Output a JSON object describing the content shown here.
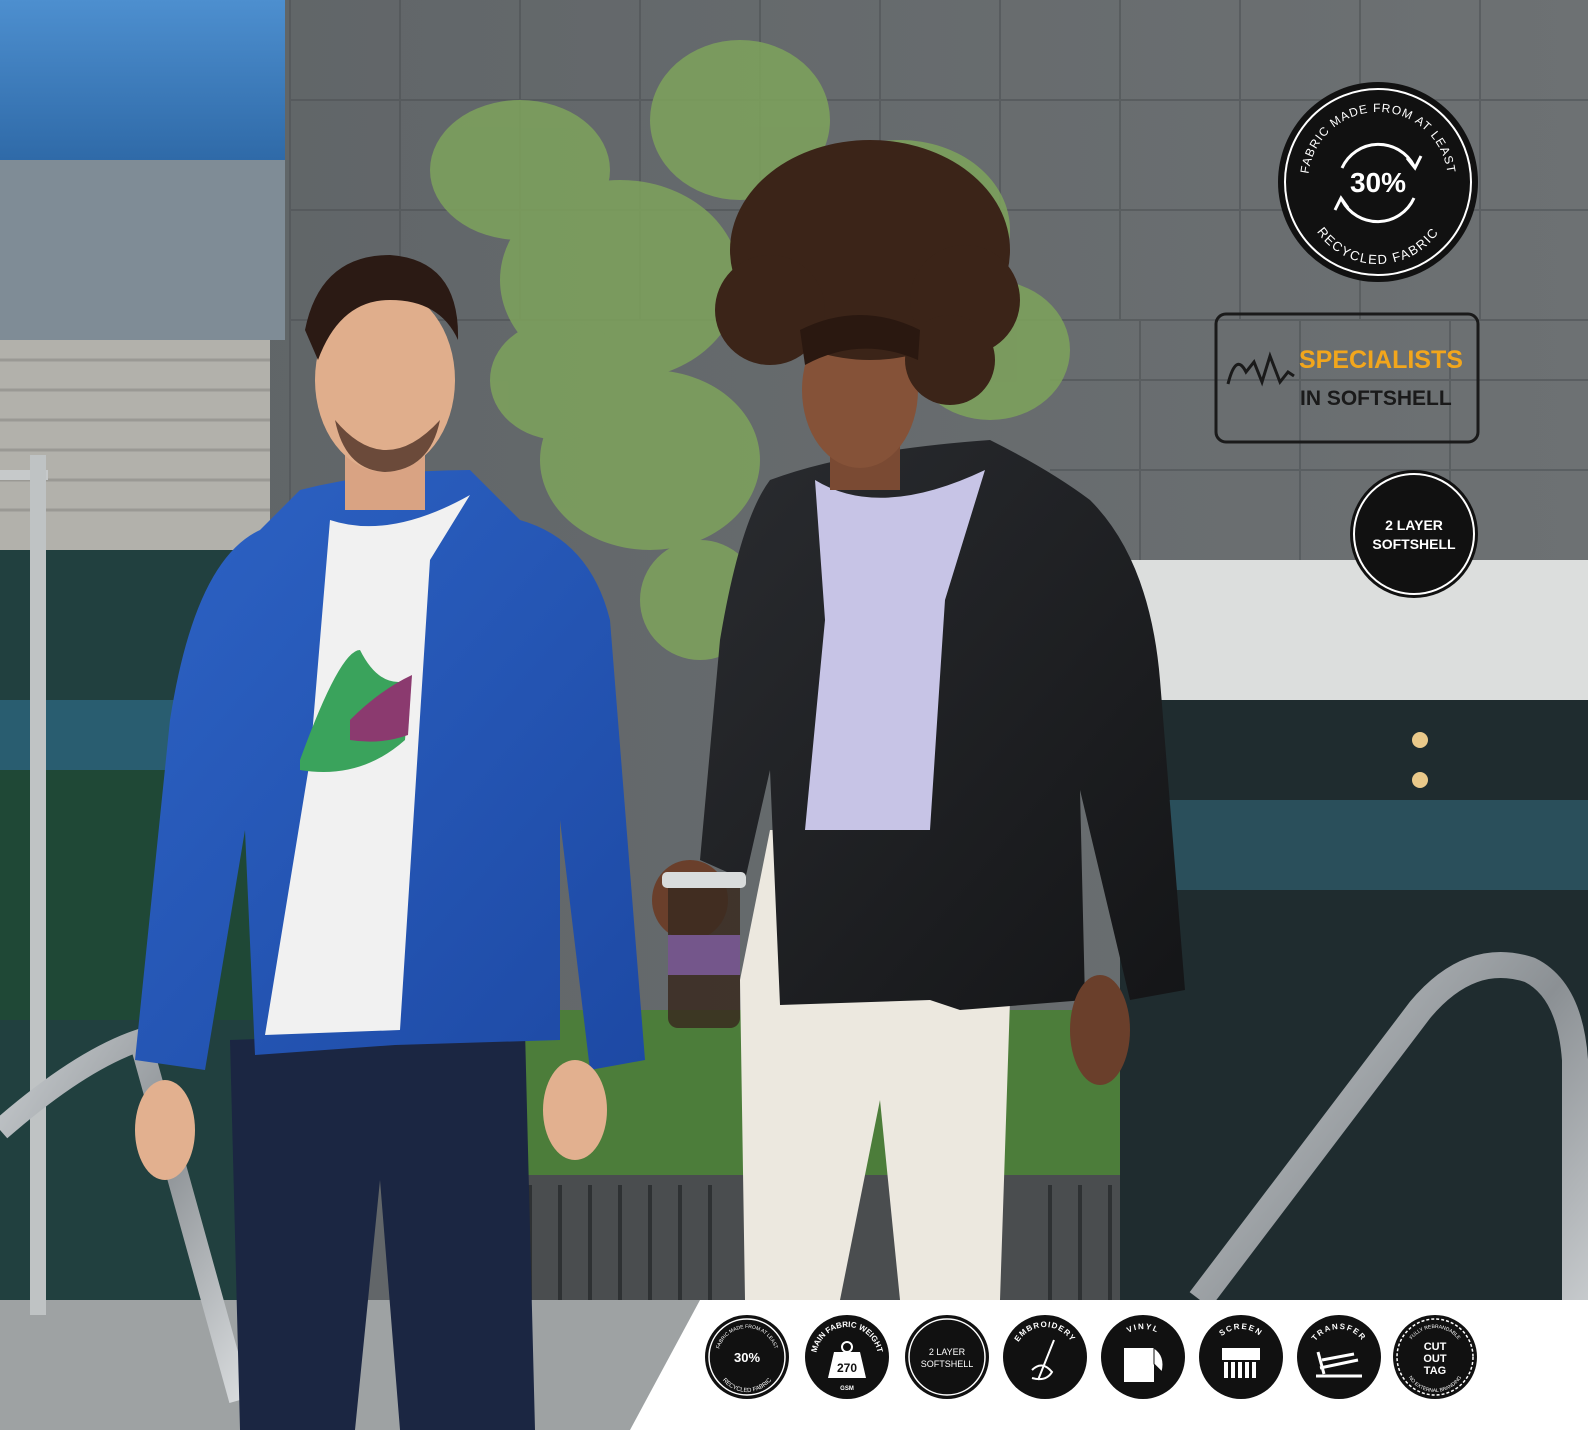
{
  "badges": {
    "recycled": {
      "arc_top": "FABRIC MADE FROM AT LEAST",
      "percent": "30%",
      "arc_bottom": "RECYCLED FABRIC"
    },
    "specialists": {
      "line1": "SPECIALISTS",
      "line2": "IN SOFTSHELL",
      "accent_color": "#f2a61c"
    },
    "layer": {
      "line1": "2 LAYER",
      "line2": "SOFTSHELL"
    }
  },
  "icon_strip": {
    "recycled": {
      "arc_top": "FABRIC MADE FROM AT LEAST",
      "percent": "30%",
      "arc_bottom": "RECYCLED FABRIC"
    },
    "weight": {
      "arc_top": "MAIN FABRIC WEIGHT",
      "value": "270",
      "unit": "GSM"
    },
    "layer": {
      "line1": "2 LAYER",
      "line2": "SOFTSHELL"
    },
    "embroidery": {
      "label": "EMBROIDERY"
    },
    "vinyl": {
      "label": "VINYL"
    },
    "screen": {
      "label": "SCREEN"
    },
    "transfer": {
      "label": "TRANSFER"
    },
    "cut_out_tag": {
      "arc_top": "FULLY REBRANDABLE",
      "line1": "CUT",
      "line2": "OUT",
      "line3": "TAG",
      "arc_bottom": "NO EXTERNAL BRANDING"
    }
  }
}
